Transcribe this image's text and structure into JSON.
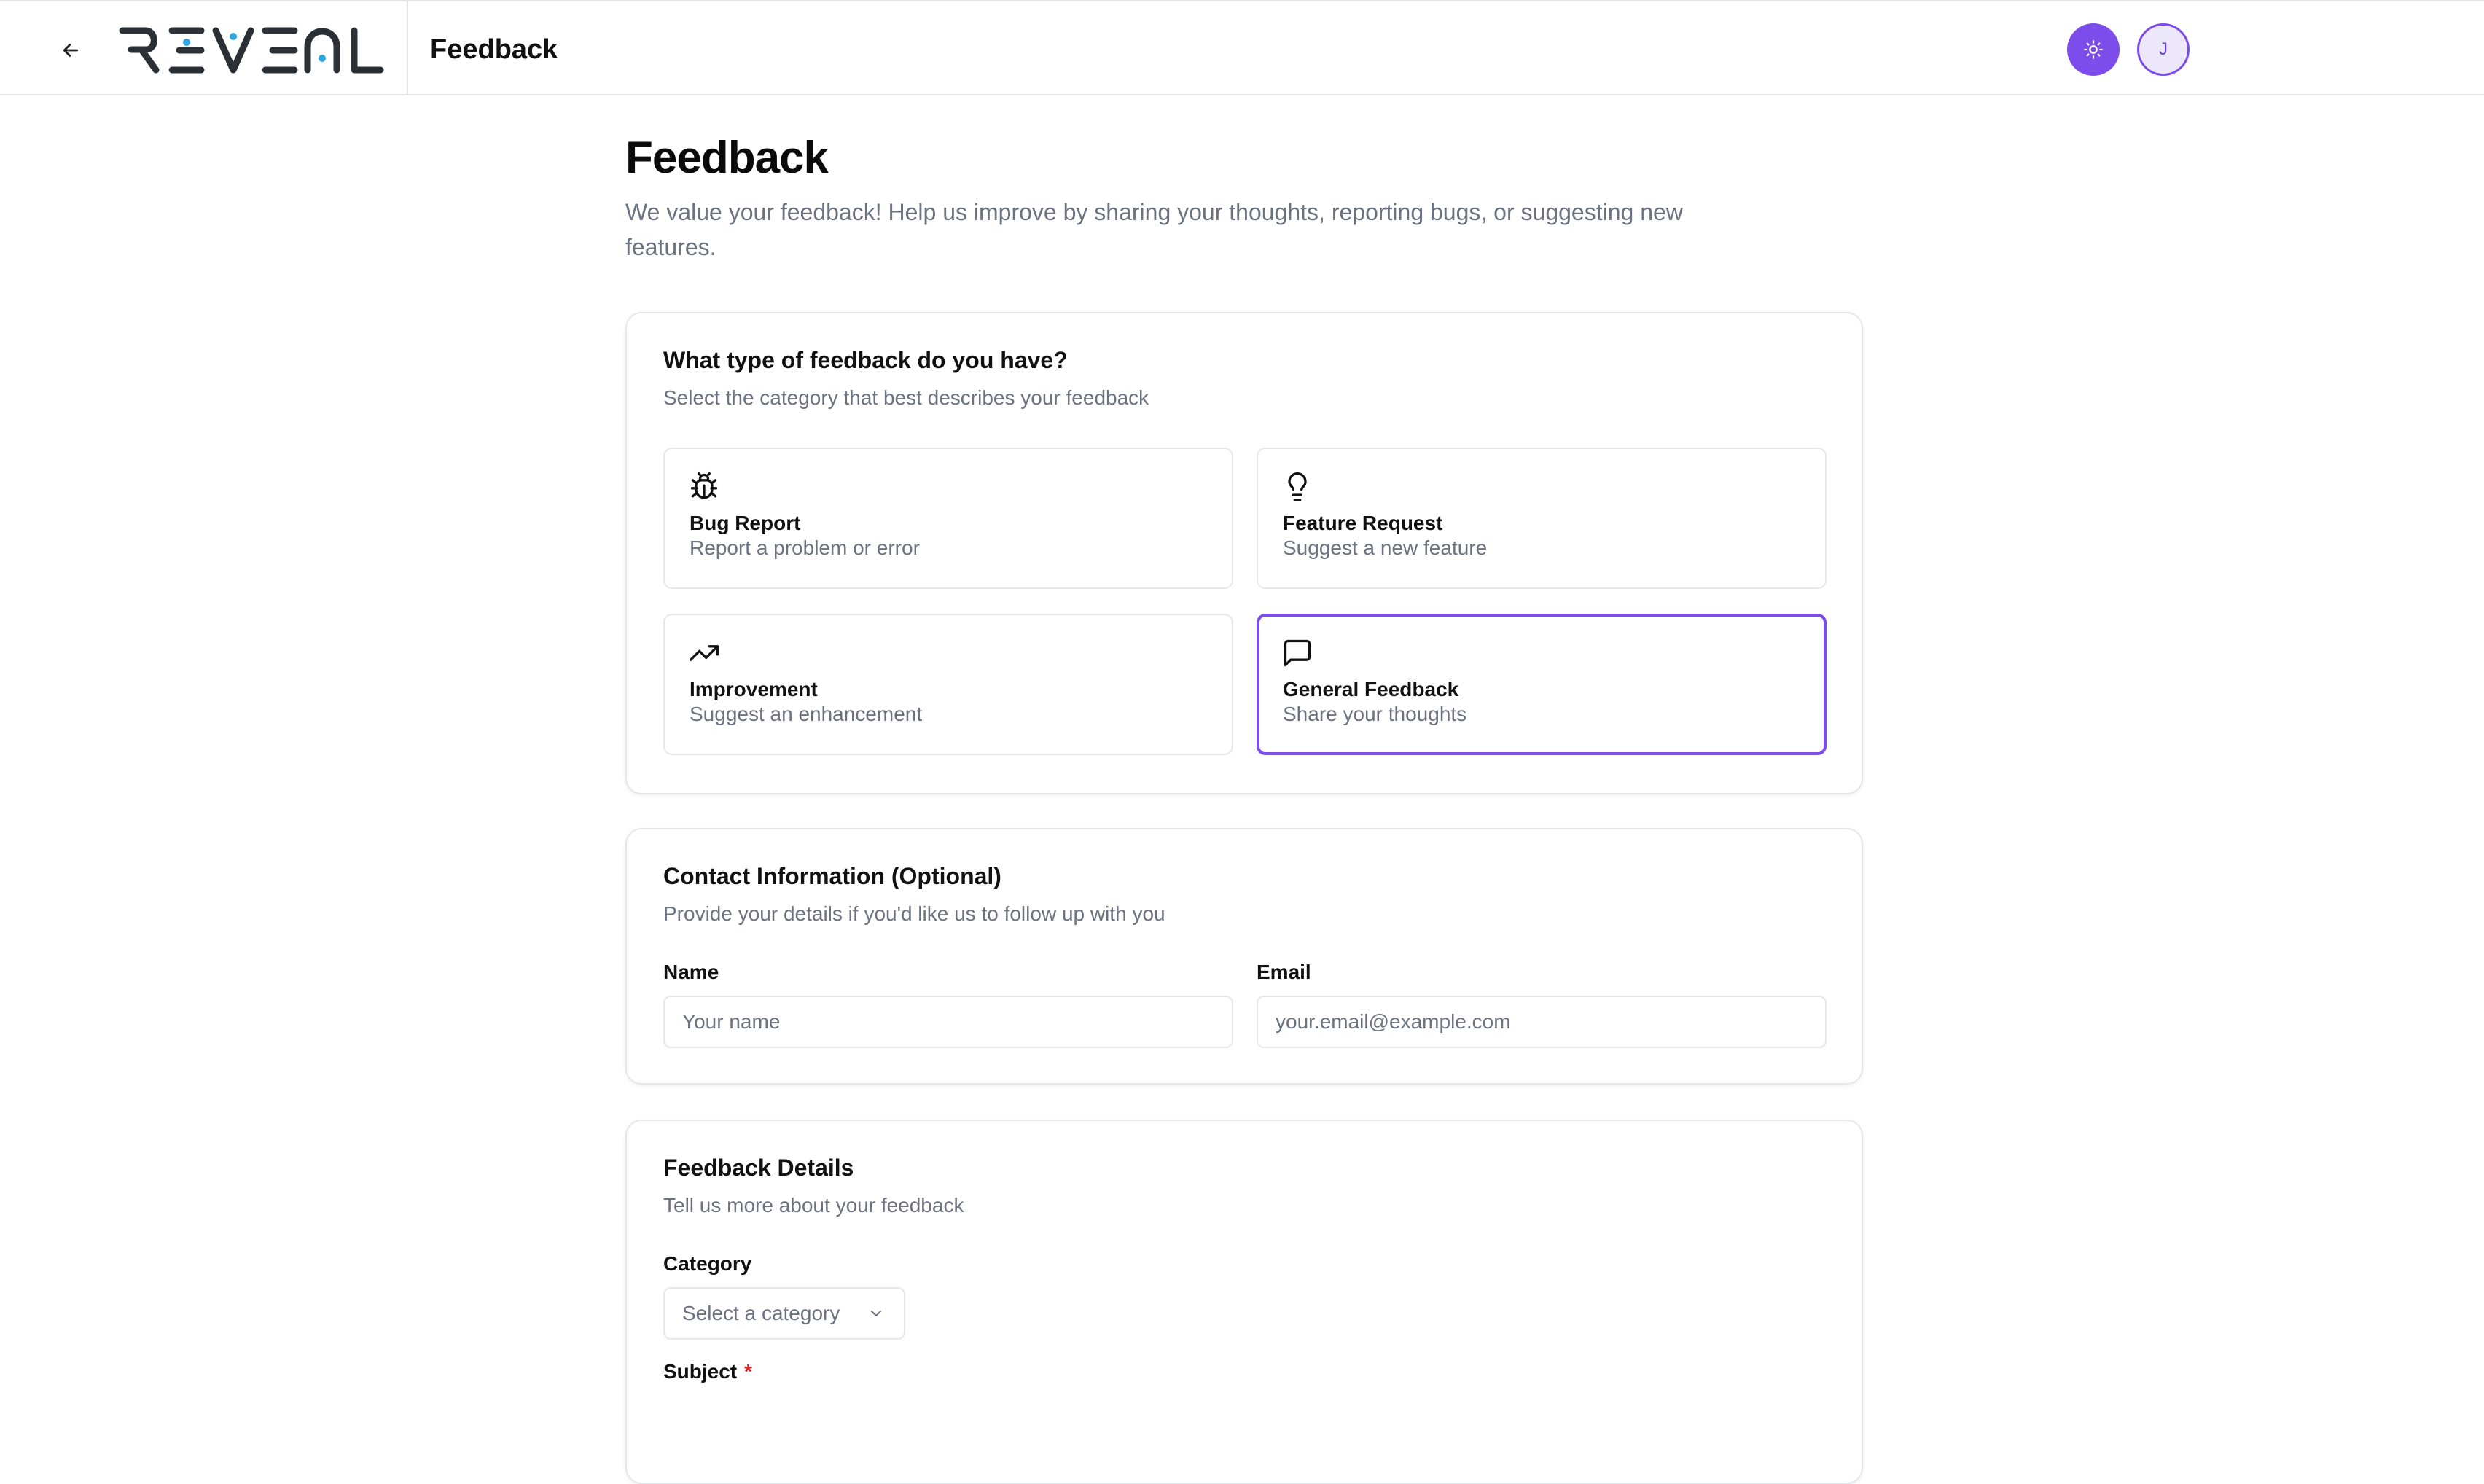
{
  "header": {
    "back_label": "←",
    "logo_text": "REVEAL",
    "title": "Feedback",
    "avatar_initial": "J"
  },
  "page": {
    "title": "Feedback",
    "subtitle": "We value your feedback! Help us improve by sharing your thoughts, reporting bugs, or suggesting new features."
  },
  "feedback_type": {
    "title": "What type of feedback do you have?",
    "description": "Select the category that best describes your feedback",
    "options": [
      {
        "icon": "bug-icon",
        "title": "Bug Report",
        "description": "Report a problem or error",
        "selected": false
      },
      {
        "icon": "lightbulb-icon",
        "title": "Feature Request",
        "description": "Suggest a new feature",
        "selected": false
      },
      {
        "icon": "trending-up-icon",
        "title": "Improvement",
        "description": "Suggest an enhancement",
        "selected": false
      },
      {
        "icon": "message-square-icon",
        "title": "General Feedback",
        "description": "Share your thoughts",
        "selected": true
      }
    ]
  },
  "contact": {
    "title": "Contact Information (Optional)",
    "description": "Provide your details if you'd like us to follow up with you",
    "name_label": "Name",
    "name_placeholder": "Your name",
    "email_label": "Email",
    "email_placeholder": "your.email@example.com"
  },
  "details": {
    "title": "Feedback Details",
    "description": "Tell us more about your feedback",
    "category_label": "Category",
    "category_placeholder": "Select a category",
    "subject_label": "Subject",
    "required_mark": "*"
  },
  "colors": {
    "accent": "#7c4dea",
    "border": "#e5e7eb",
    "muted_text": "#6b7280",
    "required": "#dc2626"
  }
}
